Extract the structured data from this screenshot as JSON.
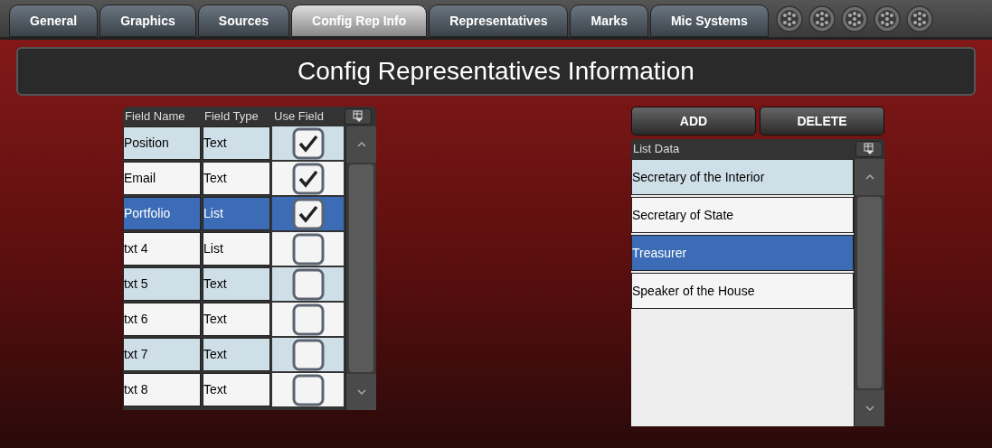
{
  "tabs": [
    {
      "label": "General",
      "selected": false
    },
    {
      "label": "Graphics",
      "selected": false
    },
    {
      "label": "Sources",
      "selected": false
    },
    {
      "label": "Config Rep Info",
      "selected": true
    },
    {
      "label": "Representatives",
      "selected": false
    },
    {
      "label": "Marks",
      "selected": false
    },
    {
      "label": "Mic Systems",
      "selected": false
    }
  ],
  "title": "Config Representatives Information",
  "fields_table": {
    "columns": [
      "Field Name",
      "Field Type",
      "Use Field"
    ],
    "rows": [
      {
        "name": "Position",
        "type": "Text",
        "checked": true,
        "selected": false
      },
      {
        "name": "Email",
        "type": "Text",
        "checked": true,
        "selected": false
      },
      {
        "name": "Portfolio",
        "type": "List",
        "checked": true,
        "selected": true
      },
      {
        "name": "txt 4",
        "type": "List",
        "checked": false,
        "selected": false
      },
      {
        "name": "txt 5",
        "type": "Text",
        "checked": false,
        "selected": false
      },
      {
        "name": "txt 6",
        "type": "Text",
        "checked": false,
        "selected": false
      },
      {
        "name": "txt 7",
        "type": "Text",
        "checked": false,
        "selected": false
      },
      {
        "name": "txt 8",
        "type": "Text",
        "checked": false,
        "selected": false
      }
    ]
  },
  "list_panel": {
    "buttons": [
      "ADD",
      "DELETE"
    ],
    "header": "List Data",
    "items": [
      {
        "label": "Secretary of the Interior",
        "selected": false
      },
      {
        "label": "Secretary of State",
        "selected": false
      },
      {
        "label": "Treasurer",
        "selected": true
      },
      {
        "label": "Speaker of the House",
        "selected": false
      }
    ]
  }
}
